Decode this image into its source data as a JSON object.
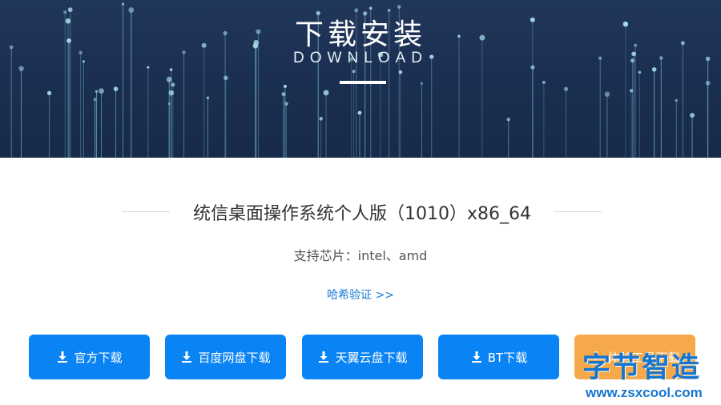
{
  "hero": {
    "title": "下载安装",
    "subtitle": "DOWNLOAD"
  },
  "product": {
    "title": "统信桌面操作系统个人版（1010）x86_64",
    "support": "支持芯片：intel、amd",
    "hash_link": "哈希验证 >>"
  },
  "buttons": [
    {
      "label": "官方下载",
      "icon": "download-icon"
    },
    {
      "label": "百度网盘下载",
      "icon": "download-icon"
    },
    {
      "label": "天翼云盘下载",
      "icon": "download-icon"
    },
    {
      "label": "BT下载",
      "icon": "download-icon"
    },
    {
      "label": "体验工具下载",
      "icon": "download-icon"
    }
  ],
  "watermark": {
    "text": "字节智造",
    "url": "www.zsxcool.com"
  },
  "colors": {
    "hero_bg": "#1b2f52",
    "button_blue": "#0a84f5",
    "button_orange": "#f5a94a",
    "link": "#1a78d4",
    "watermark": "#1576cf"
  }
}
